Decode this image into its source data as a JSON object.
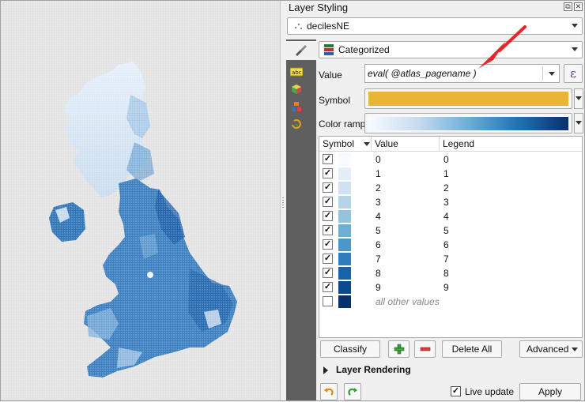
{
  "panel": {
    "title": "Layer Styling",
    "float_glyph": "⧉",
    "close_glyph": "✕",
    "layer": "decilesNE",
    "renderer": "Categorized",
    "value_label": "Value",
    "value_expression": "eval( @atlas_pagename )",
    "expression_glyph": "ε",
    "symbol_label": "Symbol",
    "symbol_color": "#e8b535",
    "color_ramp_label": "Color ramp",
    "table": {
      "headers": [
        "Symbol",
        "Value",
        "Legend"
      ],
      "rows": [
        {
          "value": "0",
          "legend": "0",
          "checked": true,
          "color": "#f7fbff"
        },
        {
          "value": "1",
          "legend": "1",
          "checked": true,
          "color": "#e3eef9"
        },
        {
          "value": "2",
          "legend": "2",
          "checked": true,
          "color": "#cfe1f2"
        },
        {
          "value": "3",
          "legend": "3",
          "checked": true,
          "color": "#b5d4e9"
        },
        {
          "value": "4",
          "legend": "4",
          "checked": true,
          "color": "#93c4de"
        },
        {
          "value": "5",
          "legend": "5",
          "checked": true,
          "color": "#6daed5"
        },
        {
          "value": "6",
          "legend": "6",
          "checked": true,
          "color": "#4b97c9"
        },
        {
          "value": "7",
          "legend": "7",
          "checked": true,
          "color": "#2f7ebc"
        },
        {
          "value": "8",
          "legend": "8",
          "checked": true,
          "color": "#1864aa"
        },
        {
          "value": "9",
          "legend": "9",
          "checked": true,
          "color": "#0a4a90"
        }
      ],
      "other_values": {
        "label": "all other values",
        "checked": false,
        "color": "#08306b"
      }
    },
    "buttons": {
      "classify": "Classify",
      "delete_all": "Delete All",
      "advanced": "Advanced"
    },
    "layer_rendering": "Layer Rendering",
    "live_update": "Live update",
    "live_update_checked": true,
    "apply": "Apply"
  },
  "colors": {
    "accent_red": "#e8262a",
    "map_background": "#e3e3e3"
  }
}
